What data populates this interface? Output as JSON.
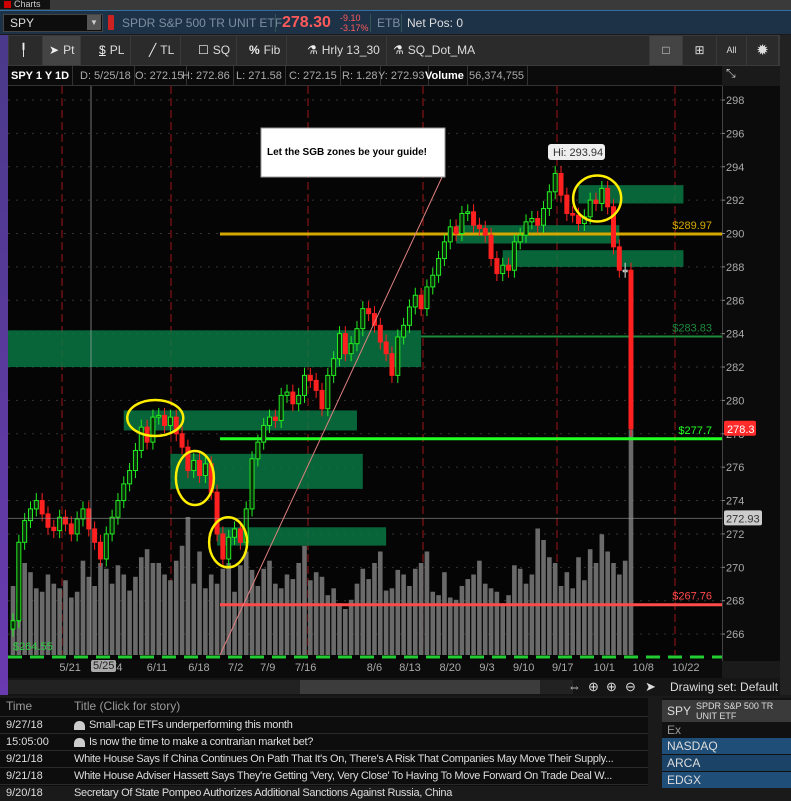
{
  "window": {
    "tab_label": "Charts"
  },
  "symbol_bar": {
    "symbol": "SPY",
    "description": "SPDR S&P 500 TR UNIT ETF",
    "last": "278.30",
    "change": "-9.10",
    "change_pct": "-3.17%",
    "status": "ETB",
    "net_pos": "Net Pos: 0"
  },
  "toolbar": {
    "items": [
      "Pt",
      "PL",
      "TL",
      "SQ",
      "Fib",
      "Hrly 13_30",
      "SQ_Dot_MA"
    ],
    "right": [
      "All"
    ]
  },
  "info": {
    "title": "SPY 1 Y 1D",
    "date": "D: 5/25/18",
    "open": "O: 272.15",
    "high": "H: 272.86",
    "low": "L: 271.58",
    "close": "C: 272.15",
    "range": "R: 1.28",
    "y": "Y: 272.93",
    "volume_label": "Volume",
    "volume": "56,374,755"
  },
  "chart_data": {
    "type": "candlestick",
    "title": "SPY 1 Y 1D",
    "ylim": [
      265,
      299
    ],
    "y_ticks": [
      266,
      268,
      270,
      272,
      274,
      276,
      278,
      280,
      282,
      284,
      286,
      288,
      290,
      292,
      294,
      296,
      298
    ],
    "x_ticks": [
      {
        "label": "5/21",
        "bar": 9.8
      },
      {
        "label": "/4",
        "bar": 18
      },
      {
        "label": "6/11",
        "bar": 24.7
      },
      {
        "label": "6/18",
        "bar": 31.9
      },
      {
        "label": "7/2",
        "bar": 38.2
      },
      {
        "label": "7/9",
        "bar": 43.7
      },
      {
        "label": "7/16",
        "bar": 50.2
      },
      {
        "label": "8/6",
        "bar": 62
      },
      {
        "label": "8/13",
        "bar": 68.1
      },
      {
        "label": "8/20",
        "bar": 75
      },
      {
        "label": "9/3",
        "bar": 81.3
      },
      {
        "label": "9/10",
        "bar": 87.6
      },
      {
        "label": "9/17",
        "bar": 94.3
      },
      {
        "label": "10/1",
        "bar": 101.4
      },
      {
        "label": "10/8",
        "bar": 108.1
      },
      {
        "label": "10/22",
        "bar": 115.4
      }
    ],
    "selected_date": "5/25",
    "closes": [
      266.8,
      271.5,
      272.8,
      273.5,
      274,
      273.2,
      272.4,
      272.2,
      273,
      272.6,
      272,
      272.9,
      273.5,
      272.3,
      271.5,
      270.5,
      272,
      273,
      274,
      275,
      275.8,
      277,
      278.4,
      277.5,
      279,
      279.1,
      278.5,
      279,
      278,
      277.2,
      275.8,
      276.4,
      275.5,
      276.2,
      274.5,
      272,
      270.5,
      271.8,
      272.3,
      271.5,
      273.5,
      276.5,
      277.5,
      278.5,
      279,
      278.8,
      280.3,
      280.5,
      279.8,
      280.3,
      281.5,
      281.2,
      280.6,
      279.5,
      281.5,
      282.5,
      284,
      282.8,
      283.4,
      284.3,
      285.5,
      285.2,
      284.5,
      283.5,
      282.8,
      281.5,
      283.8,
      284.5,
      285.6,
      286.3,
      285.5,
      286.8,
      287.5,
      288.5,
      289.5,
      290.4,
      290,
      291.2,
      291.3,
      290.5,
      290.3,
      289.9,
      288.5,
      287.6,
      288.1,
      287.8,
      289.5,
      289.9,
      290.7,
      290.9,
      290.5,
      291.5,
      292.5,
      293.6,
      292.3,
      291.2,
      291.1,
      290.6,
      291,
      292,
      291.8,
      292.7,
      291.6,
      289.2,
      287.8,
      287.8,
      278.3
    ],
    "volume_millions": [
      60,
      55,
      80,
      72,
      58,
      55,
      70,
      62,
      58,
      65,
      50,
      55,
      82,
      68,
      60,
      80,
      75,
      62,
      78,
      70,
      56,
      68,
      85,
      92,
      80,
      80,
      70,
      65,
      82,
      95,
      120,
      62,
      90,
      58,
      70,
      62,
      75,
      80,
      55,
      78,
      90,
      74,
      60,
      75,
      82,
      62,
      58,
      70,
      66,
      80,
      95,
      65,
      72,
      68,
      52,
      58,
      45,
      40,
      48,
      62,
      75,
      66,
      80,
      90,
      56,
      58,
      74,
      70,
      60,
      75,
      80,
      90,
      55,
      52,
      72,
      50,
      48,
      60,
      66,
      70,
      82,
      62,
      58,
      55,
      45,
      52,
      78,
      75,
      62,
      70,
      110,
      100,
      85,
      80,
      60,
      72,
      58,
      85,
      65,
      92,
      80,
      105,
      90,
      80,
      70,
      82,
      196
    ],
    "hi_label": "Hi: 293.94",
    "zones": [
      {
        "from": -1,
        "to": 70,
        "top": 284.2,
        "bottom": 282.0
      },
      {
        "from": 19,
        "to": 59,
        "top": 279.4,
        "bottom": 278.2
      },
      {
        "from": 27,
        "to": 60,
        "top": 276.8,
        "bottom": 274.7
      },
      {
        "from": 35,
        "to": 64,
        "top": 272.4,
        "bottom": 271.3
      },
      {
        "from": 76,
        "to": 104,
        "top": 290.5,
        "bottom": 289.4
      },
      {
        "from": 84,
        "to": 115,
        "top": 289.0,
        "bottom": 288.0
      },
      {
        "from": 97,
        "to": 115,
        "top": 292.9,
        "bottom": 291.8
      }
    ],
    "levels": [
      {
        "price": 289.97,
        "label": "$289.97",
        "color": "#d4a800",
        "from": 35.5
      },
      {
        "price": 283.83,
        "label": "$283.83",
        "color": "#1e8a3c",
        "from": 70
      },
      {
        "price": 277.7,
        "label": "$277.7",
        "color": "#22ff22",
        "from": 35.5
      },
      {
        "price": 267.76,
        "label": "$267.76",
        "color": "#ff4a4a",
        "from": 35.5
      }
    ],
    "circles": [
      {
        "bar": 24.4,
        "price": 278.95
      },
      {
        "bar": 31.2,
        "price": 275.35
      },
      {
        "bar": 36.9,
        "price": 271.5
      },
      {
        "bar": 100.2,
        "price": 292.1
      }
    ],
    "last_badge": "278.3",
    "cursor_badge": "272.93",
    "cursor_price": 272.93,
    "low_label": "$264.55",
    "note": "Let the SGB zones be your guide!"
  },
  "nav": {
    "drawing_set": "Drawing set: Default"
  },
  "news": {
    "headers": [
      "Time",
      "Title (Click for story)"
    ],
    "rows": [
      {
        "time": "9/27/18",
        "title": "Small-cap ETFs underperforming this month",
        "icon": true
      },
      {
        "time": "15:05:00",
        "title": "Is now the time to make a contrarian market bet?",
        "icon": true
      },
      {
        "time": "9/21/18",
        "title": "White House Says If China Continues On Path That It's On, There's A Risk That Companies May Move Their Supply...",
        "icon": false
      },
      {
        "time": "9/21/18",
        "title": "White House Adviser Hassett Says They're Getting 'Very, Very Close' To Having To Move Forward On Trade Deal W...",
        "icon": false
      },
      {
        "time": "9/20/18",
        "title": "Secretary Of State Pompeo Authorizes Additional Sanctions Against Russia, China",
        "icon": false
      }
    ]
  },
  "level2": {
    "symbol": "SPY",
    "description": "SPDR S&P 500 TR UNIT ETF",
    "column": "Ex",
    "exchanges": [
      "NASDAQ",
      "ARCA",
      "EDGX"
    ]
  }
}
